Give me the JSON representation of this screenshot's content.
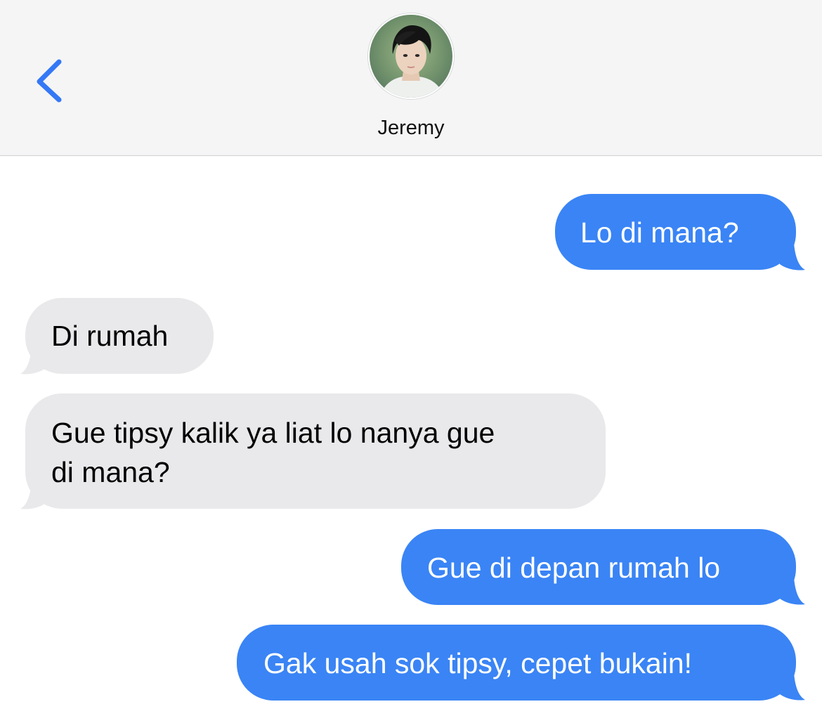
{
  "header": {
    "contact_name": "Jeremy",
    "back_icon": "chevron-left-icon",
    "accent_color": "#3478f6"
  },
  "messages": [
    {
      "direction": "outgoing",
      "lines": [
        "Lo di mana?"
      ]
    },
    {
      "direction": "incoming",
      "lines": [
        "Di rumah"
      ]
    },
    {
      "direction": "incoming",
      "lines": [
        "Gue tipsy kalik ya liat lo nanya gue",
        "di mana?"
      ]
    },
    {
      "direction": "outgoing",
      "lines": [
        "Gue di depan rumah lo"
      ]
    },
    {
      "direction": "outgoing",
      "lines": [
        "Gak usah sok tipsy, cepet bukain!"
      ]
    }
  ],
  "colors": {
    "outgoing_bubble": "#3a84f5",
    "incoming_bubble": "#e9e9eb",
    "header_bg": "#f5f5f6"
  }
}
